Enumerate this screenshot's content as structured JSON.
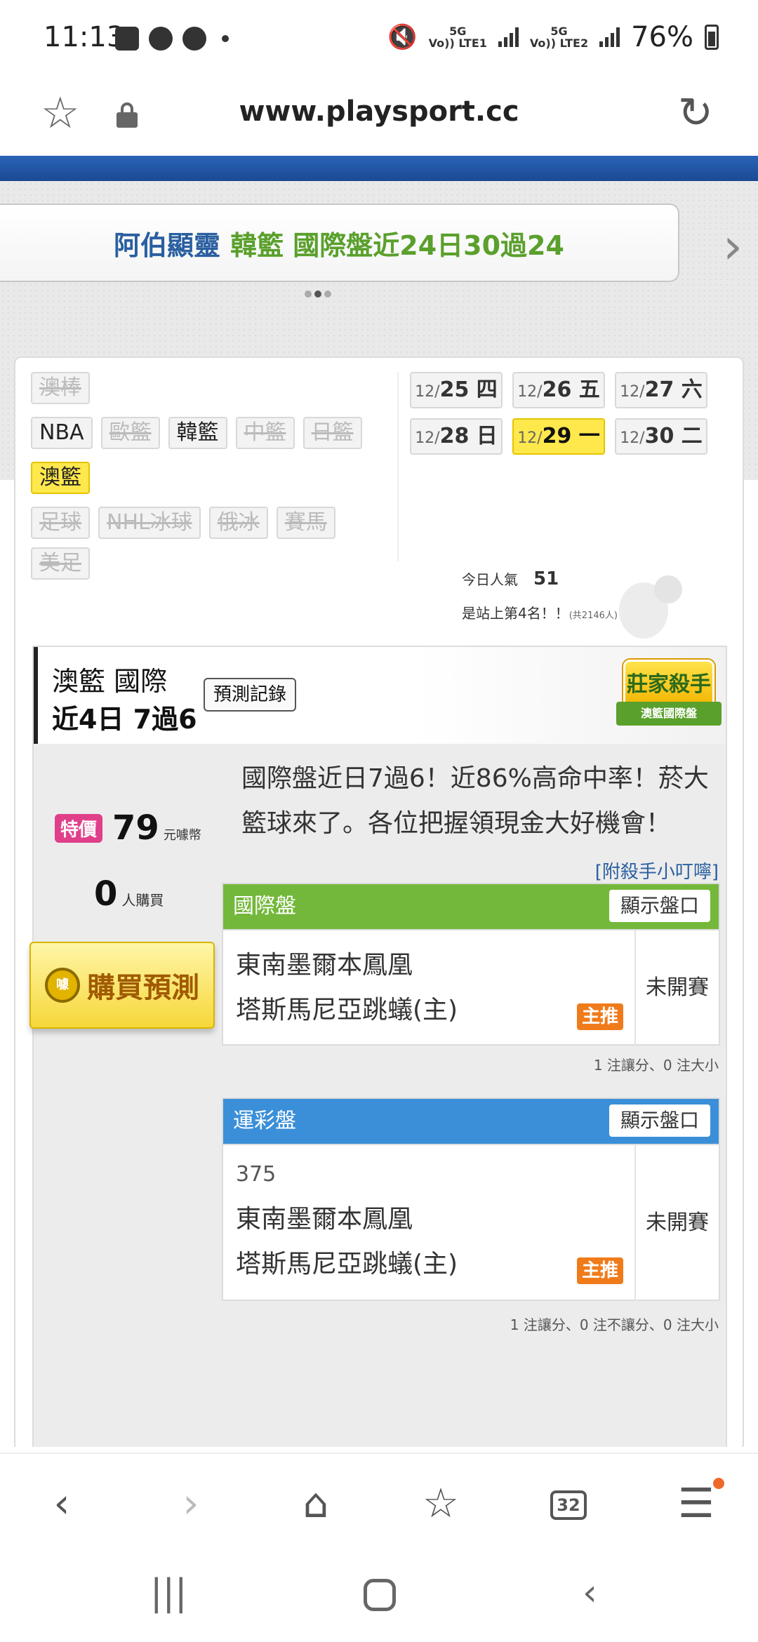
{
  "status_bar": {
    "time": "11:13",
    "net1": "Vo)) LTE1",
    "net1_gen": "5G",
    "net2": "Vo)) LTE2",
    "net2_gen": "5G",
    "battery": "76%"
  },
  "browser": {
    "url": "www.playsport.cc",
    "star_icon": "star-icon",
    "lock_icon": "lock-icon",
    "reload_icon": "reload-icon"
  },
  "banner": {
    "prefix": "阿伯顯靈",
    "text": "韓籃 國際盤近24日30過24"
  },
  "sports": {
    "row1": [
      {
        "label": "澳棒",
        "state": "disabled"
      }
    ],
    "row2": [
      {
        "label": "NBA",
        "state": "normal"
      },
      {
        "label": "歐籃",
        "state": "disabled"
      },
      {
        "label": "韓籃",
        "state": "normal"
      },
      {
        "label": "中籃",
        "state": "disabled"
      },
      {
        "label": "日籃",
        "state": "disabled"
      }
    ],
    "row3": [
      {
        "label": "澳籃",
        "state": "active"
      }
    ],
    "row4": [
      {
        "label": "足球",
        "state": "disabled"
      },
      {
        "label": "NHL冰球",
        "state": "disabled"
      },
      {
        "label": "俄冰",
        "state": "disabled"
      },
      {
        "label": "賽馬",
        "state": "disabled"
      },
      {
        "label": "美足",
        "state": "disabled"
      }
    ]
  },
  "dates": [
    {
      "prefix": "12/",
      "day": "25 四",
      "active": false
    },
    {
      "prefix": "12/",
      "day": "26 五",
      "active": false
    },
    {
      "prefix": "12/",
      "day": "27 六",
      "active": false
    },
    {
      "prefix": "12/",
      "day": "28 日",
      "active": false
    },
    {
      "prefix": "12/",
      "day": "29 一",
      "active": true
    },
    {
      "prefix": "12/",
      "day": "30 二",
      "active": false
    }
  ],
  "popularity": {
    "label": "今日人氣",
    "value": "51",
    "rank_text": "是站上第4名！！",
    "total": "(共2146人)"
  },
  "card": {
    "title1": "澳籃 國際",
    "title2": "近4日 7過6",
    "record_btn": "預測記錄",
    "badge_main": "莊家殺手",
    "badge_sub": "澳籃國際盤",
    "special_label": "特價",
    "price": "79",
    "price_unit": "元噱幣",
    "buyers": "0",
    "buyers_unit": "人購買",
    "buy_btn": "購買預測",
    "coin_label": "噱",
    "description": "國際盤近日7過6！近86%高命中率！菸大籃球來了。各位把握領現金大好機會！",
    "tips_link": "[附殺手小叮嚀]"
  },
  "intl_odds": {
    "header": "國際盤",
    "show_btn": "顯示盤口",
    "team1": "東南墨爾本鳳凰",
    "team2": "塔斯馬尼亞跳蟻(主)",
    "pick": "主推",
    "status": "未開賽",
    "note": "1 注讓分、0 注大小"
  },
  "lottery_odds": {
    "header": "運彩盤",
    "show_btn": "顯示盤口",
    "game_no": "375",
    "team1": "東南墨爾本鳳凰",
    "team2": "塔斯馬尼亞跳蟻(主)",
    "pick": "主推",
    "status": "未開賽",
    "note": "1 注讓分、0 注不讓分、0 注大小"
  },
  "nav": {
    "tab_count": "32"
  },
  "colors": {
    "brand_blue": "#2a63b8",
    "green": "#74b83b",
    "blue": "#3b8fd8",
    "highlight": "#ffe84c",
    "pick_orange": "#f07b1a"
  }
}
